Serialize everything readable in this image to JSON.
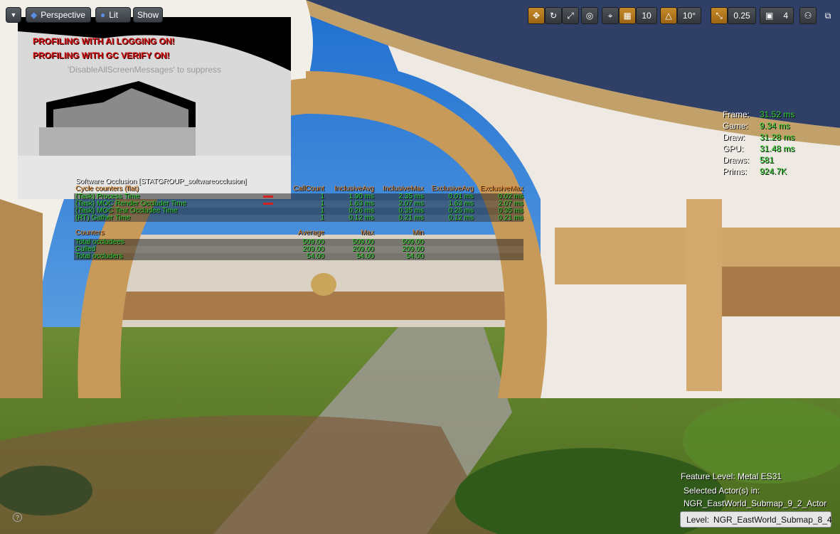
{
  "toolbar": {
    "menu_label": "",
    "perspective_label": "Perspective",
    "lit_label": "Lit",
    "show_label": "Show",
    "grid_snap_value": "10",
    "rotation_snap_value": "10°",
    "scale_snap_value": "0.25",
    "camera_speed_value": "4"
  },
  "warnings": {
    "ai_logging": "PROFILING WITH AI LOGGING ON!",
    "gc_verify": "PROFILING WITH GC VERIFY ON!",
    "suppress_hint": "'DisableAllScreenMessages' to suppress"
  },
  "stats_summary": {
    "frame_label": "Frame:",
    "frame_value": "31.52 ms",
    "game_label": "Game:",
    "game_value": "9.34 ms",
    "draw_label": "Draw:",
    "draw_value": "31.28 ms",
    "gpu_label": "GPU:",
    "gpu_value": "31.48 ms",
    "draws_label": "Draws:",
    "draws_value": "581",
    "prims_label": "Prims:",
    "prims_value": "924.7K"
  },
  "occlusion_stats": {
    "group_title": "Software Occlusion [STATGROUP_softwareocclusion]",
    "cycle_header": {
      "name": "Cycle counters (flat)",
      "callcount": "CallCount",
      "incl_avg": "InclusiveAvg",
      "incl_max": "InclusiveMax",
      "excl_avg": "ExclusiveAvg",
      "excl_max": "ExclusiveMax"
    },
    "cycle_rows": [
      {
        "name": "(Task) Process Time",
        "callcount": "1",
        "incl_avg": "1.90 ms",
        "incl_max": "2.35 ms",
        "excl_avg": "0.01 ms",
        "excl_max": "0.02 ms"
      },
      {
        "name": "(Task) MOC Render Occluder Time",
        "callcount": "1",
        "incl_avg": "1.63 ms",
        "incl_max": "2.07 ms",
        "excl_avg": "1.63 ms",
        "excl_max": "2.07 ms"
      },
      {
        "name": "(Task) MOC Test Occludee Time",
        "callcount": "1",
        "incl_avg": "0.26 ms",
        "incl_max": "0.35 ms",
        "excl_avg": "0.26 ms",
        "excl_max": "0.35 ms"
      },
      {
        "name": "(RT) Gather Time",
        "callcount": "1",
        "incl_avg": "0.12 ms",
        "incl_max": "0.21 ms",
        "excl_avg": "0.12 ms",
        "excl_max": "0.21 ms"
      }
    ],
    "counter_header": {
      "name": "Counters",
      "average": "Average",
      "max": "Max",
      "min": "Min"
    },
    "counter_rows": [
      {
        "name": "Total occludees",
        "average": "509.00",
        "max": "509.00",
        "min": "509.00"
      },
      {
        "name": "Culled",
        "average": "209.00",
        "max": "209.00",
        "min": "209.00"
      },
      {
        "name": "Total occluders",
        "average": "54.00",
        "max": "54.00",
        "min": "54.00"
      }
    ]
  },
  "info": {
    "feature_level": "Feature Level:  Metal ES31",
    "selected_actor_label": "Selected Actor(s) in:",
    "selected_actor_value": "NGR_EastWorld_Submap_9_2_Actor",
    "level_label": "Level:",
    "level_value": "NGR_EastWorld_Submap_8_4"
  },
  "colors": {
    "warning": "#d01010",
    "stat_value": "#2fd02f",
    "stat_header": "#e88a2c",
    "snap_active": "#c78a28"
  }
}
